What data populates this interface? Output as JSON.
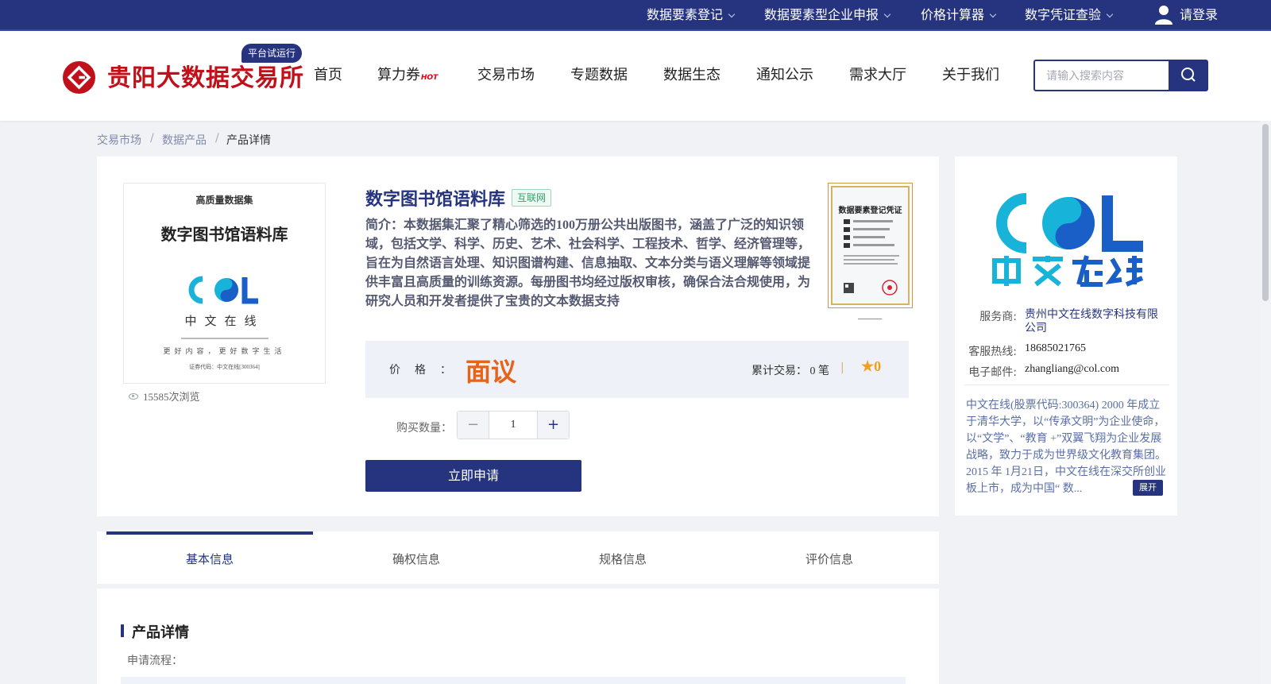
{
  "topbar": {
    "items": [
      {
        "label": "数据要素登记"
      },
      {
        "label": "数据要素型企业申报"
      },
      {
        "label": "价格计算器"
      },
      {
        "label": "数字凭证查验"
      }
    ],
    "login_label": "请登录"
  },
  "header": {
    "brand": "贵阳大数据交易所",
    "trial_badge": "平台试运行",
    "nav": [
      {
        "label": "首页"
      },
      {
        "label": "算力券",
        "badge": "HOT"
      },
      {
        "label": "交易市场"
      },
      {
        "label": "专题数据"
      },
      {
        "label": "数据生态"
      },
      {
        "label": "通知公示"
      },
      {
        "label": "需求大厅"
      },
      {
        "label": "关于我们"
      }
    ],
    "search": {
      "placeholder": "请输入搜索内容",
      "value": ""
    }
  },
  "breadcrumb": {
    "items": [
      "交易市场",
      "数据产品",
      "产品详情"
    ],
    "separator": "/"
  },
  "product": {
    "cover": {
      "top_label": "高质量数据集",
      "title": "数字图书馆语料库",
      "brand_latin": "COL",
      "brand_cn": "中文在线",
      "slogan": "更好内容，更好数字生活",
      "code": "证券代码：中文在线[300364]"
    },
    "views": "15585次浏览",
    "title": "数字图书馆语料库",
    "tag": "互联网",
    "intro": "简介：本数据集汇聚了精心筛选的100万册公共出版图书，涵盖了广泛的知识领域，包括文学、科学、历史、艺术、社会科学、工程技术、哲学、经济管理等，旨在为自然语言处理、知识图谱构建、信息抽取、文本分类与语义理解等领域提供丰富且高质量的训练资源。每册图书均经过版权审核，确保合法合规使用，为研究人员和开发者提供了宝贵的文本数据支持",
    "certificate_title": "数据要素登记凭证",
    "price_label": "价格：",
    "price_value": "面议",
    "trade_count": "累计交易： 0 笔",
    "rating": "0",
    "quantity_label": "购买数量：",
    "quantity": "1",
    "apply_label": "立即申请"
  },
  "vendor": {
    "logo_latin": "COL",
    "logo_cn": "中文在线",
    "provider_label": "服务商:",
    "provider": "贵州中文在线数字科技有限公司",
    "hotline_label": "客服热线:",
    "hotline": "18685021765",
    "email_label": "电子邮件:",
    "email": "zhangliang@col.com",
    "description": "中文在线(股票代码:300364) 2000 年成立于清华大学，以“传承文明”为企业使命，以“文学”、“教育 +”双翼飞翔为企业发展战略，致力于成为世界级文化教育集团。2015 年 1月21日，中文在线在深交所创业板上市，成为中国“ 数...",
    "expand_label": "展开"
  },
  "tabs": [
    {
      "label": "基本信息",
      "active": true
    },
    {
      "label": "确权信息",
      "active": false
    },
    {
      "label": "规格信息",
      "active": false
    },
    {
      "label": "评价信息",
      "active": false
    }
  ],
  "details": {
    "title": "产品详情",
    "subtitle": "申请流程："
  },
  "colors": {
    "brand_navy": "#26347f",
    "brand_red": "#c0111b",
    "price_orange": "#e8631a",
    "col_cyan": "#17b3d9",
    "col_blue": "#1a5fc8",
    "tag_green": "#32a06a"
  }
}
